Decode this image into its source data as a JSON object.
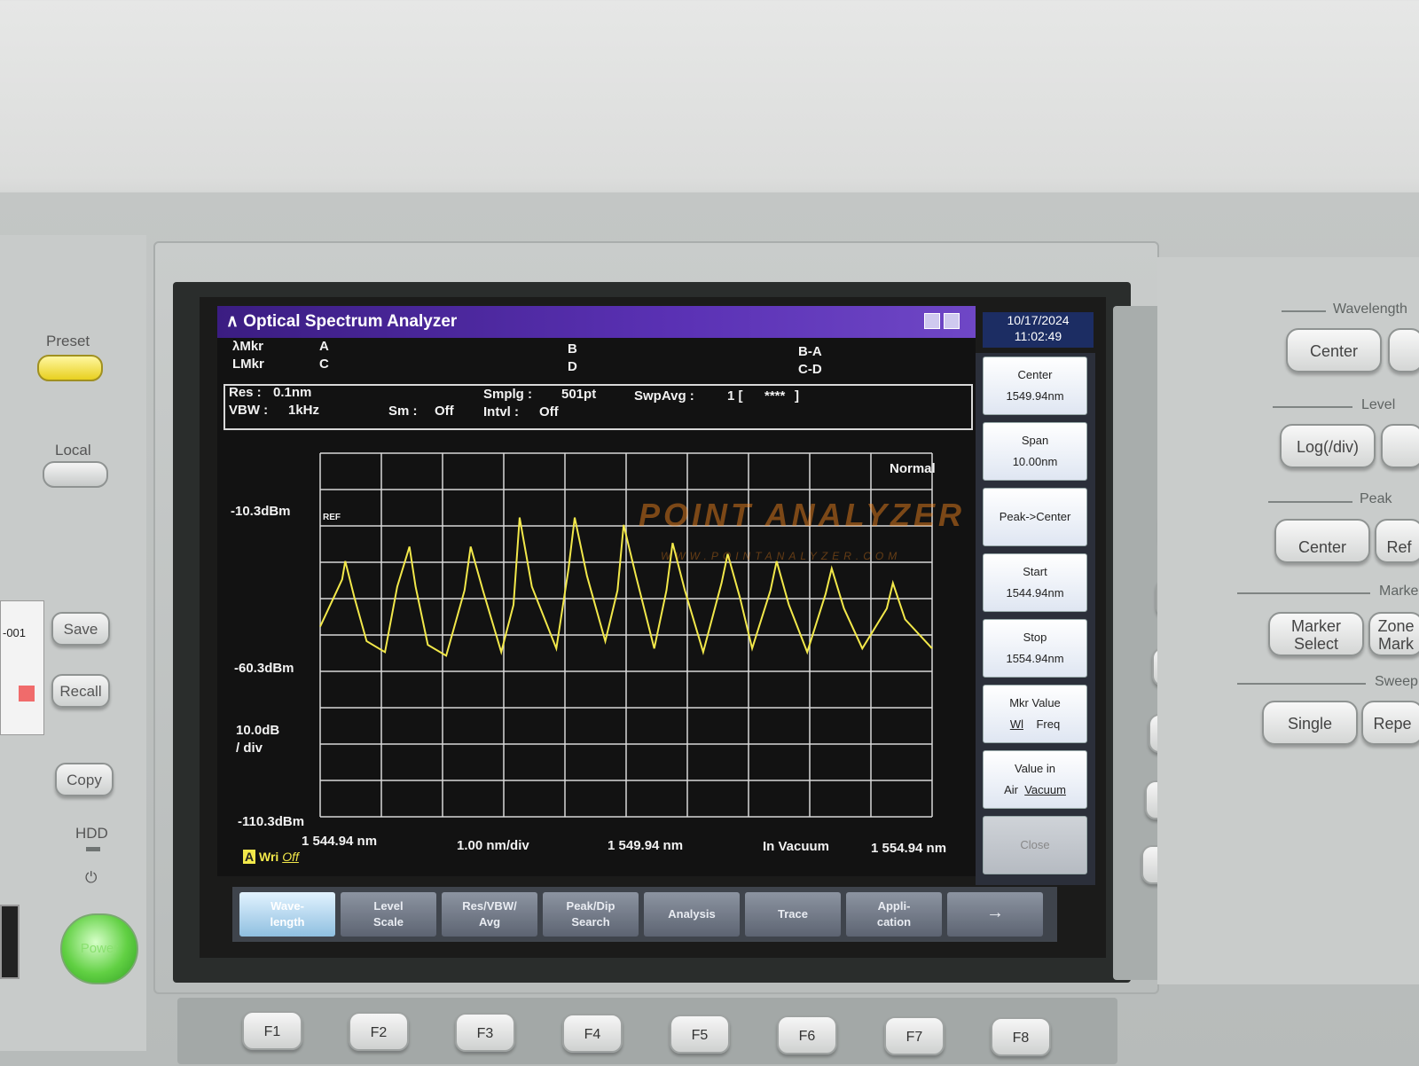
{
  "window": {
    "title": "Optical Spectrum Analyzer",
    "date": "10/17/2024",
    "time": "11:02:49"
  },
  "markers": {
    "lambda_label": "λMkr",
    "level_label": "LMkr",
    "a": "A",
    "b": "B",
    "c": "C",
    "d": "D",
    "ba": "B-A",
    "cd": "C-D"
  },
  "params": {
    "res": "Res :",
    "res_val": "0.1nm",
    "vbw": "VBW :",
    "vbw_val": "1kHz",
    "sm": "Sm :",
    "sm_val": "Off",
    "smplg": "Smplg :",
    "smplg_val": "501pt",
    "intvl": "Intvl :",
    "intvl_val": "Off",
    "swpavg": "SwpAvg :",
    "swpavg_val": "1 [",
    "swpavg_stars": "****",
    "swpavg_close": "]"
  },
  "graph": {
    "mode": "Normal",
    "ref_label": "REF",
    "top_level": "-10.3dBm",
    "mid_level": "-60.3dBm",
    "bottom_level": "-110.3dBm",
    "scale": "10.0dB",
    "scale_unit": "/ div",
    "x_start": "1 544.94 nm",
    "x_div": "1.00 nm/div",
    "x_center": "1 549.94 nm",
    "x_medium": "In Vacuum",
    "x_stop": "1 554.94 nm",
    "trace_label": "A",
    "trace_mode": "Wri",
    "trace_state": "Off",
    "trace_color": "#f2e84a"
  },
  "chart_data": {
    "type": "line",
    "xlabel": "",
    "ylabel": "",
    "xlim": [
      1544.94,
      1554.94
    ],
    "ylim": [
      -110.3,
      -10.3
    ],
    "grid": true,
    "series": [
      {
        "x": [
          1544.94,
          1545.3,
          1545.35,
          1545.5,
          1545.7,
          1546.0,
          1546.2,
          1546.4,
          1546.5,
          1546.7,
          1547.0,
          1547.3,
          1547.4,
          1547.6,
          1547.9,
          1548.1,
          1548.2,
          1548.4,
          1548.8,
          1549.0,
          1549.1,
          1549.3,
          1549.6,
          1549.8,
          1549.9,
          1550.1,
          1550.4,
          1550.6,
          1550.7,
          1550.9,
          1551.2,
          1551.5,
          1551.6,
          1551.8,
          1552.0,
          1552.3,
          1552.4,
          1552.6,
          1552.9,
          1553.2,
          1553.3,
          1553.5,
          1553.8,
          1554.2,
          1554.3,
          1554.5,
          1554.94
        ],
        "y": [
          -58,
          -45,
          -40,
          -50,
          -62,
          -65,
          -47,
          -36,
          -47,
          -63,
          -66,
          -48,
          -36,
          -48,
          -65,
          -52,
          -28,
          -47,
          -64,
          -42,
          -28,
          -44,
          -62,
          -48,
          -30,
          -44,
          -64,
          -48,
          -35,
          -48,
          -65,
          -46,
          -38,
          -50,
          -64,
          -48,
          -40,
          -52,
          -65,
          -49,
          -42,
          -53,
          -64,
          -53,
          -46,
          -56,
          -64
        ]
      }
    ]
  },
  "softkeys": [
    {
      "label": "Center",
      "value": "1549.94nm"
    },
    {
      "label": "Span",
      "value": "10.00nm"
    },
    {
      "label": "Peak->Center",
      "value": ""
    },
    {
      "label": "Start",
      "value": "1544.94nm"
    },
    {
      "label": "Stop",
      "value": "1554.94nm"
    },
    {
      "label": "Mkr Value",
      "opt1": "Wl",
      "opt2": "Freq"
    },
    {
      "label": "Value in",
      "opt1": "Air",
      "opt2": "Vacuum"
    },
    {
      "label": "Close"
    }
  ],
  "menu_tabs": [
    {
      "line1": "Wave-",
      "line2": "length"
    },
    {
      "line1": "Level",
      "line2": "Scale"
    },
    {
      "line1": "Res/VBW/",
      "line2": "Avg"
    },
    {
      "line1": "Peak/Dip",
      "line2": "Search"
    },
    {
      "line1": "Analysis",
      "line2": ""
    },
    {
      "line1": "Trace",
      "line2": ""
    },
    {
      "line1": "Appli-",
      "line2": "cation"
    },
    {
      "line1": "→",
      "line2": ""
    }
  ],
  "side_fkeys": [
    "f1",
    "f2",
    "f3",
    "f4",
    "f5",
    "f6",
    "f7",
    "f8"
  ],
  "bottom_fkeys": [
    "F1",
    "F2",
    "F3",
    "F4",
    "F5",
    "F6",
    "F7",
    "F8"
  ],
  "right_panel": {
    "wavelength": "Wavelength",
    "center": "Center",
    "level": "Level",
    "log": "Log(/div)",
    "peak": "Peak",
    "peak_center": "Center",
    "peak_ref": "Ref",
    "marker": "Marker",
    "marker_select_1": "Marker",
    "marker_select_2": "Select",
    "zone_1": "Zone",
    "zone_2": "Mark",
    "sweep": "Sweep",
    "single": "Single",
    "repeat": "Repe"
  },
  "left_panel": {
    "preset": "Preset",
    "local": "Local",
    "save": "Save",
    "recall": "Recall",
    "copy": "Copy",
    "hdd": "HDD",
    "power_symbol": "⏻",
    "power": "Power",
    "label_tag": "-001"
  },
  "watermark": {
    "main": "POINT ANALYZER",
    "sub": "WWW.POINTANALYZER.COM"
  }
}
